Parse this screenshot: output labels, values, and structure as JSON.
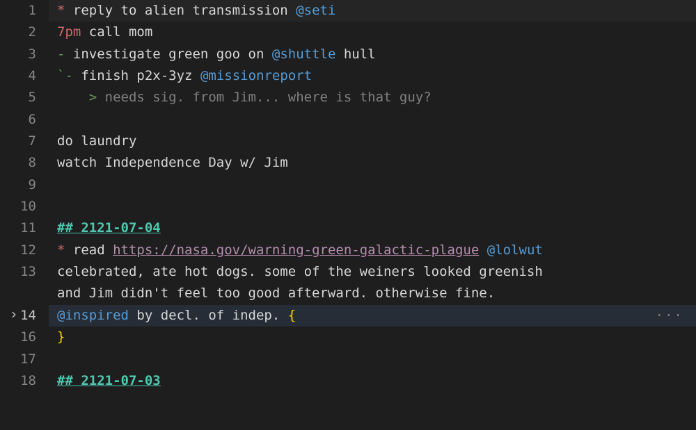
{
  "lines": [
    {
      "num": "1",
      "highlighted": true,
      "tokens": [
        {
          "cls": "tok-star",
          "t": "*"
        },
        {
          "cls": "tok-text",
          "t": " reply to alien transmission "
        },
        {
          "cls": "tok-tag",
          "t": "@seti"
        }
      ]
    },
    {
      "num": "2",
      "tokens": [
        {
          "cls": "tok-time",
          "t": "7pm"
        },
        {
          "cls": "tok-text",
          "t": " call mom"
        }
      ]
    },
    {
      "num": "3",
      "tokens": [
        {
          "cls": "tok-bullet",
          "t": "-"
        },
        {
          "cls": "tok-text",
          "t": " investigate green goo on "
        },
        {
          "cls": "tok-tag",
          "t": "@shuttle"
        },
        {
          "cls": "tok-text",
          "t": " hull"
        }
      ]
    },
    {
      "num": "4",
      "tokens": [
        {
          "cls": "tok-tick",
          "t": "`"
        },
        {
          "cls": "tok-bullet",
          "t": "-"
        },
        {
          "cls": "tok-text",
          "t": " finish p2x-3yz "
        },
        {
          "cls": "tok-tag",
          "t": "@missionreport"
        }
      ]
    },
    {
      "num": "5",
      "tokens": [
        {
          "cls": "tok-plain",
          "t": "    "
        },
        {
          "cls": "tok-quote-mark",
          "t": ">"
        },
        {
          "cls": "tok-quote",
          "t": " needs sig. from Jim... where is that guy?"
        }
      ]
    },
    {
      "num": "6",
      "tokens": []
    },
    {
      "num": "7",
      "tokens": [
        {
          "cls": "tok-text",
          "t": "do laundry"
        }
      ]
    },
    {
      "num": "8",
      "tokens": [
        {
          "cls": "tok-text",
          "t": "watch Independence Day w/ Jim"
        }
      ]
    },
    {
      "num": "9",
      "tokens": []
    },
    {
      "num": "10",
      "tokens": []
    },
    {
      "num": "11",
      "tokens": [
        {
          "cls": "tok-heading",
          "t": "## 2121-07-04"
        }
      ]
    },
    {
      "num": "12",
      "tokens": [
        {
          "cls": "tok-star",
          "t": "*"
        },
        {
          "cls": "tok-text",
          "t": " read "
        },
        {
          "cls": "tok-link",
          "t": "https://nasa.gov/warning-green-galactic-plague"
        },
        {
          "cls": "tok-text",
          "t": " "
        },
        {
          "cls": "tok-tag",
          "t": "@lolwut"
        }
      ]
    },
    {
      "num": "13",
      "wrap": true,
      "tokens": [
        {
          "cls": "tok-text",
          "t": "celebrated, ate hot dogs. some of the weiners looked greenish "
        }
      ],
      "wrap_tokens": [
        {
          "cls": "tok-text",
          "t": "and Jim didn't feel too good afterward. otherwise fine."
        }
      ]
    },
    {
      "num": "14",
      "current": true,
      "fold": true,
      "dots": "···",
      "tokens": [
        {
          "cls": "tok-tag",
          "t": "@inspired"
        },
        {
          "cls": "tok-text",
          "t": " by decl. of indep. "
        },
        {
          "cls": "tok-brace",
          "t": "{"
        }
      ]
    },
    {
      "num": "16",
      "tokens": [
        {
          "cls": "tok-brace",
          "t": "}"
        }
      ]
    },
    {
      "num": "17",
      "tokens": []
    },
    {
      "num": "18",
      "tokens": [
        {
          "cls": "tok-heading",
          "t": "## 2121-07-03"
        }
      ]
    }
  ]
}
